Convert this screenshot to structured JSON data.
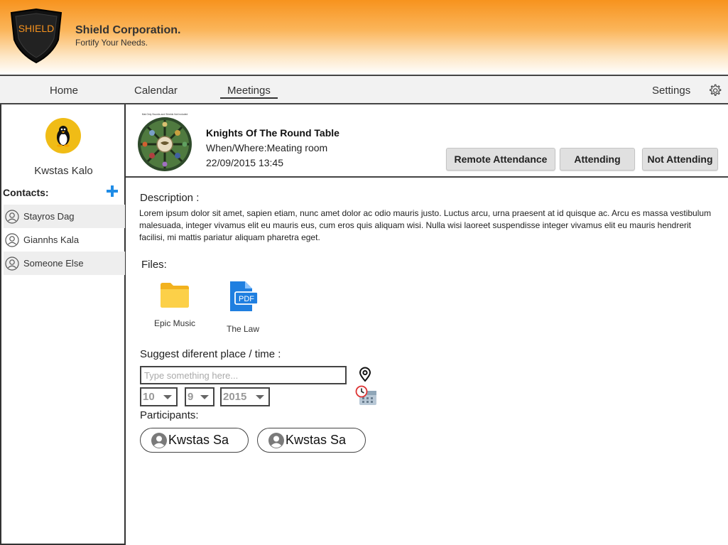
{
  "brand": {
    "logo_text": "SHIELD",
    "name": "Shield Corporation.",
    "tagline": "Fortify Your Needs."
  },
  "nav": {
    "home": "Home",
    "calendar": "Calendar",
    "meetings": "Meetings",
    "settings": "Settings",
    "active": "Meetings"
  },
  "sidebar": {
    "user_name": "Kwstas Kalo",
    "contacts_label": "Contacts:",
    "contacts": [
      {
        "name": "Stayros Dag"
      },
      {
        "name": "Giannhs Kala"
      },
      {
        "name": "Someone Else"
      }
    ]
  },
  "meeting": {
    "image_caption": "Mat Only Swords and Shields Not Included",
    "title": "Knights Of The Round Table",
    "where": "When/Where:Meating room",
    "when": "22/09/2015  13:45",
    "buttons": {
      "remote": "Remote Attendance",
      "attending": "Attending",
      "not_attending": "Not Attending"
    }
  },
  "description": {
    "label": "Description :",
    "text": "Lorem ipsum dolor sit amet, sapien etiam, nunc amet dolor ac odio mauris justo. Luctus arcu, urna praesent at id quisque ac. Arcu es massa vestibulum malesuada, integer vivamus elit eu mauris eus, cum eros quis aliquam wisi. Nulla wisi laoreet suspendisse integer vivamus elit eu mauris hendrerit facilisi, mi mattis pariatur aliquam pharetra eget."
  },
  "files": {
    "label": "Files:",
    "items": [
      {
        "name": "Epic Music",
        "icon": "folder-icon"
      },
      {
        "name": "The Law",
        "icon": "pdf-icon",
        "badge": "PDF"
      }
    ]
  },
  "suggest": {
    "label": "Suggest diferent place / time :",
    "placeholder": "Type something here...",
    "value": "",
    "day": "10",
    "month": "9",
    "year": "2015"
  },
  "participants": {
    "label": "Participants:",
    "items": [
      {
        "name": "Kwstas Sa"
      },
      {
        "name": "Kwstas Sa"
      }
    ]
  },
  "colors": {
    "header_orange": "#f7931e",
    "avatar_yellow": "#f0bc16",
    "accent_blue": "#1f8ce6",
    "folder_yellow": "#f7c32e"
  }
}
